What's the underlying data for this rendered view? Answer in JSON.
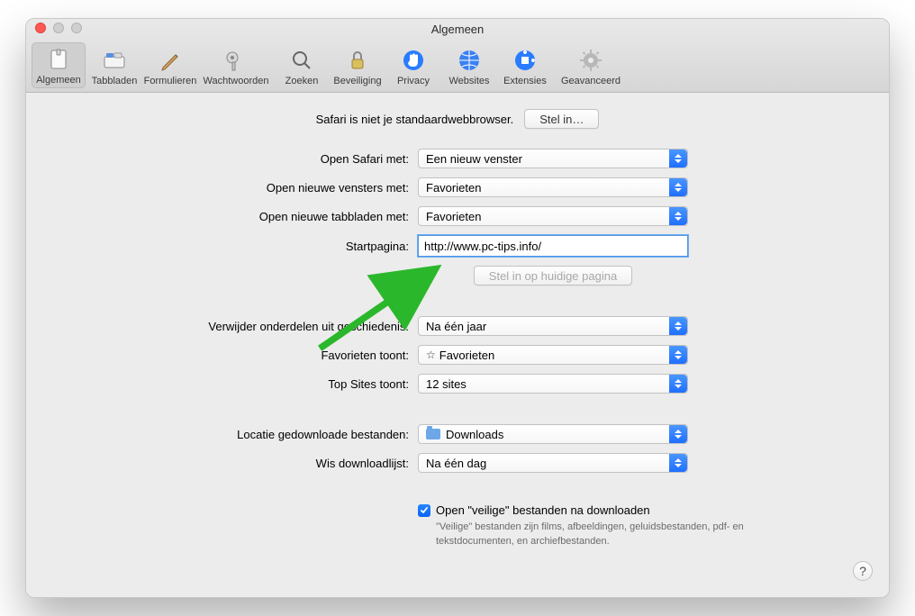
{
  "title": "Algemeen",
  "toolbar": [
    {
      "id": "general",
      "label": "Algemeen",
      "selected": true
    },
    {
      "id": "tabs",
      "label": "Tabbladen"
    },
    {
      "id": "forms",
      "label": "Formulieren"
    },
    {
      "id": "passwords",
      "label": "Wachtwoorden",
      "wider": true
    },
    {
      "id": "search",
      "label": "Zoeken"
    },
    {
      "id": "security",
      "label": "Beveiliging"
    },
    {
      "id": "privacy",
      "label": "Privacy"
    },
    {
      "id": "websites",
      "label": "Websites"
    },
    {
      "id": "extensions",
      "label": "Extensies"
    },
    {
      "id": "advanced",
      "label": "Geavanceerd",
      "wider": true
    }
  ],
  "banner": {
    "text": "Safari is niet je standaardwebbrowser.",
    "button": "Stel in…"
  },
  "fields": {
    "open_safari": {
      "label": "Open Safari met:",
      "value": "Een nieuw venster"
    },
    "open_windows": {
      "label": "Open nieuwe vensters met:",
      "value": "Favorieten"
    },
    "open_tabs": {
      "label": "Open nieuwe tabbladen met:",
      "value": "Favorieten"
    },
    "homepage": {
      "label": "Startpagina:",
      "value": "http://www.pc-tips.info/"
    },
    "homepage_button": "Stel in op huidige pagina",
    "remove_history": {
      "label": "Verwijder onderdelen uit geschiedenis:",
      "value": "Na één jaar"
    },
    "favorites": {
      "label": "Favorieten toont:",
      "value": "Favorieten"
    },
    "topsites": {
      "label": "Top Sites toont:",
      "value": "12 sites"
    },
    "downloads": {
      "label": "Locatie gedownloade bestanden:",
      "value": "Downloads"
    },
    "clearlist": {
      "label": "Wis downloadlijst:",
      "value": "Na één dag"
    }
  },
  "safe_files": {
    "label": "Open \"veilige\" bestanden na downloaden",
    "hint": "\"Veilige\" bestanden zijn films, afbeeldingen, geluidsbestanden, pdf- en tekstdocumenten, en archiefbestanden."
  },
  "help_label": "?"
}
